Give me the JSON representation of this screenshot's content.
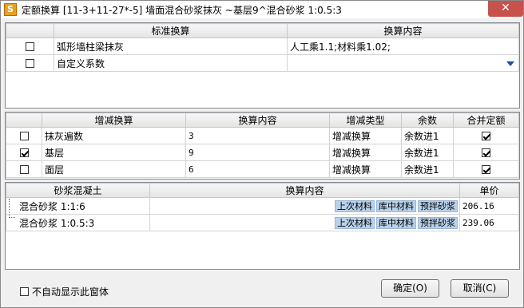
{
  "window": {
    "title": "定额换算 [11-3+11-27*-5] 墙面混合砂浆抹灰 ~基层9^混合砂浆 1:0.5:3",
    "app_icon_glyph": "S",
    "close_glyph": "✕"
  },
  "standard": {
    "headers": [
      "标准换算",
      "换算内容"
    ],
    "rows": [
      {
        "checked": false,
        "name": "弧形墙柱梁抹灰",
        "content": "人工乘1.1;材料乘1.02;"
      },
      {
        "checked": false,
        "name": "自定义系数",
        "content": ""
      }
    ]
  },
  "incdec": {
    "headers": [
      "增减换算",
      "换算内容",
      "增减类型",
      "余数",
      "合并定额"
    ],
    "rows": [
      {
        "checked": false,
        "name": "抹灰遍数",
        "value": "3",
        "type": "增减换算",
        "remainder": "余数进1",
        "merge": true
      },
      {
        "checked": true,
        "name": "基层",
        "value": "9",
        "type": "增减换算",
        "remainder": "余数进1",
        "merge": true
      },
      {
        "checked": false,
        "name": "面层",
        "value": "6",
        "type": "增减换算",
        "remainder": "余数进1",
        "merge": true
      }
    ]
  },
  "mortar": {
    "headers": [
      "砂浆混凝土",
      "换算内容",
      "单价"
    ],
    "buttons": [
      "上次材料",
      "库中材料",
      "预拌砂浆"
    ],
    "rows": [
      {
        "name": "混合砂浆 1:1:6",
        "price": "206.16"
      },
      {
        "name": "混合砂浆 1:0.5:3",
        "price": "239.06"
      }
    ]
  },
  "footer": {
    "no_auto_show": "不自动显示此窗体",
    "ok": "确定(O)",
    "cancel": "取消(C)"
  }
}
